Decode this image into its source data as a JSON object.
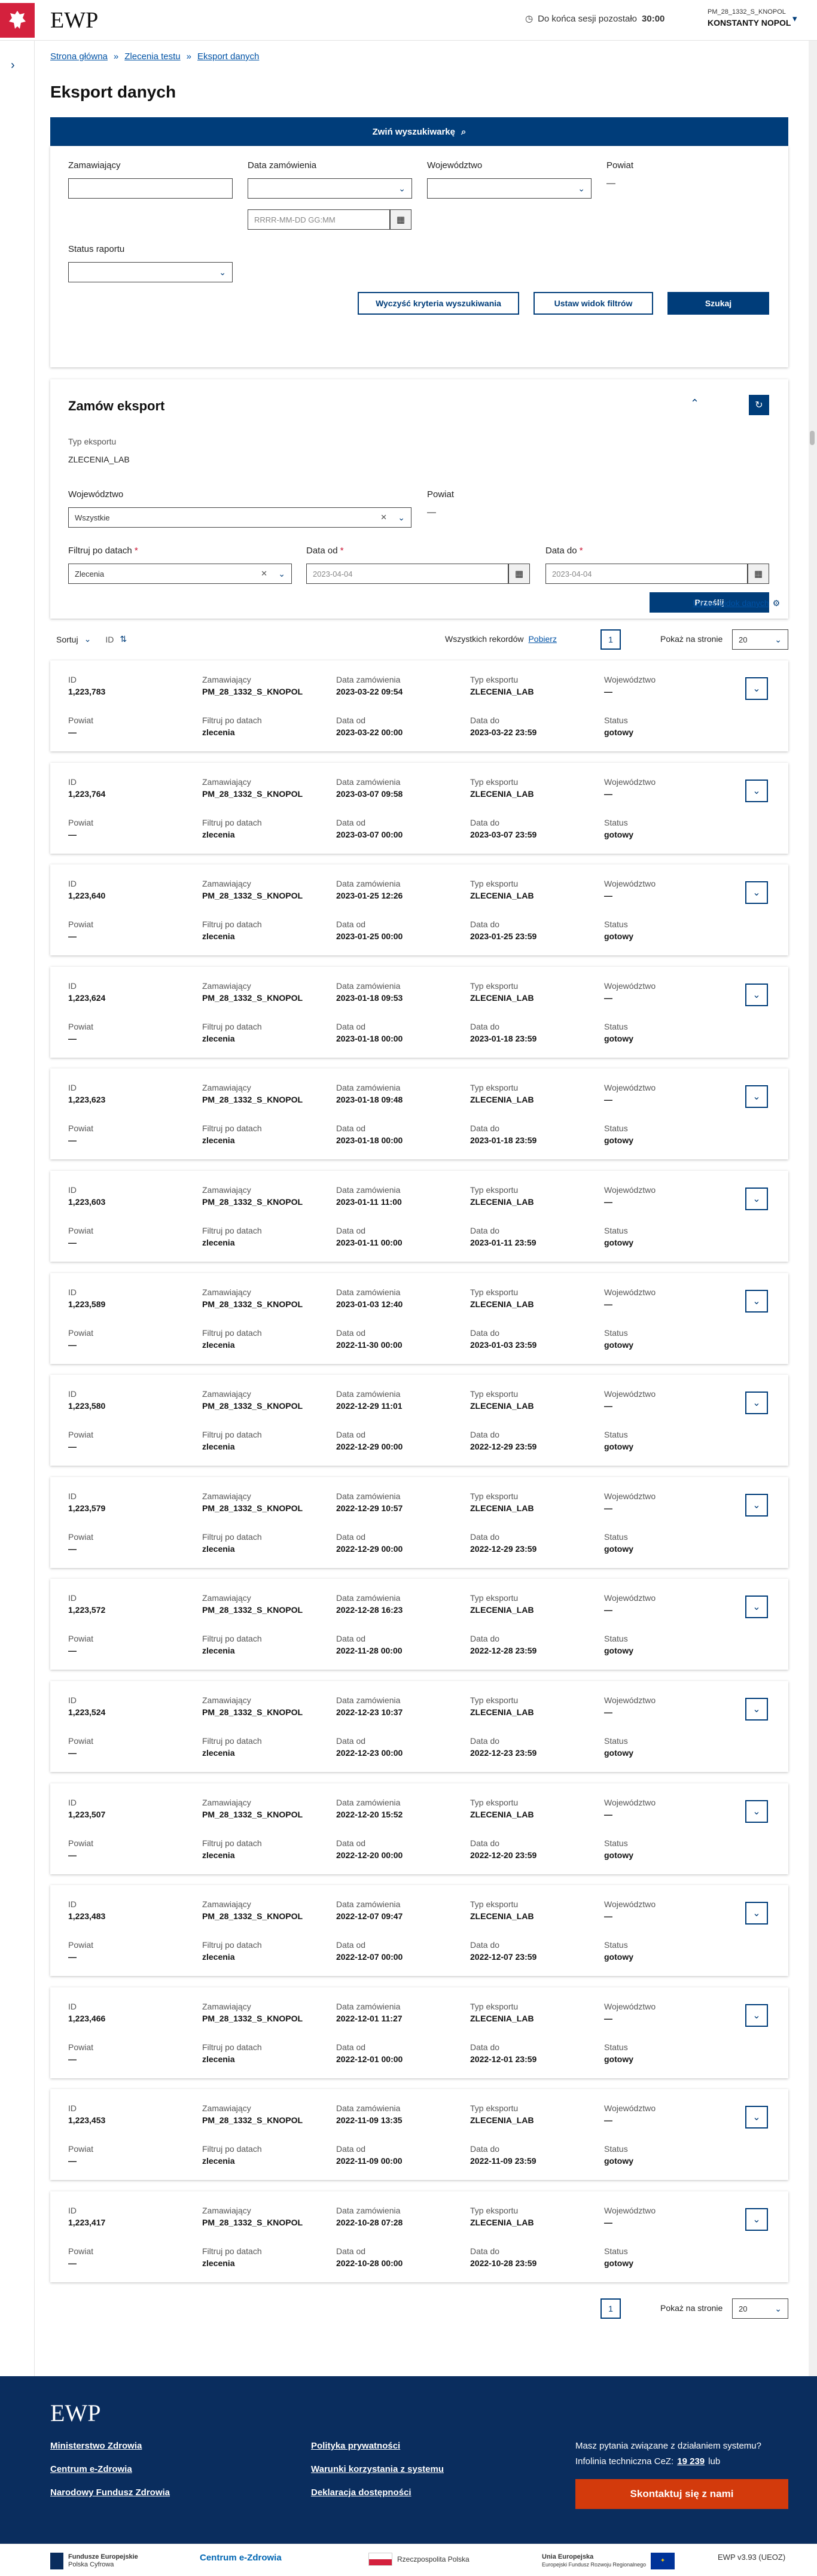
{
  "header": {
    "app_title": "EWP",
    "session_label": "Do końca sesji pozostało",
    "session_time": "30:00",
    "user_id": "PM_28_1332_S_KNOPOL",
    "user_name": "KONSTANTY NOPOL"
  },
  "breadcrumb": [
    "Strona główna",
    "Zlecenia testu",
    "Eksport danych"
  ],
  "page_title": "Eksport danych",
  "search": {
    "toggle_label": "Zwiń wyszukiwarkę",
    "zamawiajacy_label": "Zamawiający",
    "data_zam_label": "Data zamówienia",
    "date_placeholder": "RRRR-MM-DD GG:MM",
    "wojewodztwo_label": "Województwo",
    "powiat_label": "Powiat",
    "powiat_value": "—",
    "status_label": "Status raportu",
    "clear_label": "Wyczyść kryteria wyszukiwania",
    "setview_label": "Ustaw widok filtrów",
    "search_label": "Szukaj"
  },
  "export": {
    "title": "Zamów eksport",
    "type_label": "Typ eksportu",
    "type_value": "ZLECENIA_LAB",
    "woj_label": "Województwo",
    "woj_value": "Wszystkie",
    "powiat_label": "Powiat",
    "powiat_value": "—",
    "filter_label": "Filtruj po datach",
    "filter_value": "Zlecenia",
    "date_from_label": "Data od",
    "date_from_value": "2023-04-04",
    "date_to_label": "Data do",
    "date_to_value": "2023-04-04",
    "submit_label": "Prześlij"
  },
  "list": {
    "set_view_label": "Ustaw widok danych",
    "sort_label": "Sortuj",
    "sort_field": "ID",
    "total_label": "Wszystkich rekordów",
    "download_label": "Pobierz",
    "page": "1",
    "per_page_label": "Pokaż na stronie",
    "per_page": "20"
  },
  "col_labels": {
    "id": "ID",
    "zam": "Zamawiający",
    "data": "Data zamówienia",
    "typ": "Typ eksportu",
    "woj": "Województwo",
    "powiat": "Powiat",
    "filtr": "Filtruj po datach",
    "od": "Data od",
    "do": "Data do",
    "status": "Status"
  },
  "records": [
    {
      "id": "1,223,783",
      "zam": "PM_28_1332_S_KNOPOL",
      "data": "2023-03-22 09:54",
      "typ": "ZLECENIA_LAB",
      "woj": "—",
      "powiat": "—",
      "filtr": "zlecenia",
      "od": "2023-03-22 00:00",
      "do": "2023-03-22 23:59",
      "status": "gotowy"
    },
    {
      "id": "1,223,764",
      "zam": "PM_28_1332_S_KNOPOL",
      "data": "2023-03-07 09:58",
      "typ": "ZLECENIA_LAB",
      "woj": "—",
      "powiat": "—",
      "filtr": "zlecenia",
      "od": "2023-03-07 00:00",
      "do": "2023-03-07 23:59",
      "status": "gotowy"
    },
    {
      "id": "1,223,640",
      "zam": "PM_28_1332_S_KNOPOL",
      "data": "2023-01-25 12:26",
      "typ": "ZLECENIA_LAB",
      "woj": "—",
      "powiat": "—",
      "filtr": "zlecenia",
      "od": "2023-01-25 00:00",
      "do": "2023-01-25 23:59",
      "status": "gotowy"
    },
    {
      "id": "1,223,624",
      "zam": "PM_28_1332_S_KNOPOL",
      "data": "2023-01-18 09:53",
      "typ": "ZLECENIA_LAB",
      "woj": "—",
      "powiat": "—",
      "filtr": "zlecenia",
      "od": "2023-01-18 00:00",
      "do": "2023-01-18 23:59",
      "status": "gotowy"
    },
    {
      "id": "1,223,623",
      "zam": "PM_28_1332_S_KNOPOL",
      "data": "2023-01-18 09:48",
      "typ": "ZLECENIA_LAB",
      "woj": "—",
      "powiat": "—",
      "filtr": "zlecenia",
      "od": "2023-01-18 00:00",
      "do": "2023-01-18 23:59",
      "status": "gotowy"
    },
    {
      "id": "1,223,603",
      "zam": "PM_28_1332_S_KNOPOL",
      "data": "2023-01-11 11:00",
      "typ": "ZLECENIA_LAB",
      "woj": "—",
      "powiat": "—",
      "filtr": "zlecenia",
      "od": "2023-01-11 00:00",
      "do": "2023-01-11 23:59",
      "status": "gotowy"
    },
    {
      "id": "1,223,589",
      "zam": "PM_28_1332_S_KNOPOL",
      "data": "2023-01-03 12:40",
      "typ": "ZLECENIA_LAB",
      "woj": "—",
      "powiat": "—",
      "filtr": "zlecenia",
      "od": "2022-11-30 00:00",
      "do": "2023-01-03 23:59",
      "status": "gotowy"
    },
    {
      "id": "1,223,580",
      "zam": "PM_28_1332_S_KNOPOL",
      "data": "2022-12-29 11:01",
      "typ": "ZLECENIA_LAB",
      "woj": "—",
      "powiat": "—",
      "filtr": "zlecenia",
      "od": "2022-12-29 00:00",
      "do": "2022-12-29 23:59",
      "status": "gotowy"
    },
    {
      "id": "1,223,579",
      "zam": "PM_28_1332_S_KNOPOL",
      "data": "2022-12-29 10:57",
      "typ": "ZLECENIA_LAB",
      "woj": "—",
      "powiat": "—",
      "filtr": "zlecenia",
      "od": "2022-12-29 00:00",
      "do": "2022-12-29 23:59",
      "status": "gotowy"
    },
    {
      "id": "1,223,572",
      "zam": "PM_28_1332_S_KNOPOL",
      "data": "2022-12-28 16:23",
      "typ": "ZLECENIA_LAB",
      "woj": "—",
      "powiat": "—",
      "filtr": "zlecenia",
      "od": "2022-11-28 00:00",
      "do": "2022-12-28 23:59",
      "status": "gotowy"
    },
    {
      "id": "1,223,524",
      "zam": "PM_28_1332_S_KNOPOL",
      "data": "2022-12-23 10:37",
      "typ": "ZLECENIA_LAB",
      "woj": "—",
      "powiat": "—",
      "filtr": "zlecenia",
      "od": "2022-12-23 00:00",
      "do": "2022-12-23 23:59",
      "status": "gotowy"
    },
    {
      "id": "1,223,507",
      "zam": "PM_28_1332_S_KNOPOL",
      "data": "2022-12-20 15:52",
      "typ": "ZLECENIA_LAB",
      "woj": "—",
      "powiat": "—",
      "filtr": "zlecenia",
      "od": "2022-12-20 00:00",
      "do": "2022-12-20 23:59",
      "status": "gotowy"
    },
    {
      "id": "1,223,483",
      "zam": "PM_28_1332_S_KNOPOL",
      "data": "2022-12-07 09:47",
      "typ": "ZLECENIA_LAB",
      "woj": "—",
      "powiat": "—",
      "filtr": "zlecenia",
      "od": "2022-12-07 00:00",
      "do": "2022-12-07 23:59",
      "status": "gotowy"
    },
    {
      "id": "1,223,466",
      "zam": "PM_28_1332_S_KNOPOL",
      "data": "2022-12-01 11:27",
      "typ": "ZLECENIA_LAB",
      "woj": "—",
      "powiat": "—",
      "filtr": "zlecenia",
      "od": "2022-12-01 00:00",
      "do": "2022-12-01 23:59",
      "status": "gotowy"
    },
    {
      "id": "1,223,453",
      "zam": "PM_28_1332_S_KNOPOL",
      "data": "2022-11-09 13:35",
      "typ": "ZLECENIA_LAB",
      "woj": "—",
      "powiat": "—",
      "filtr": "zlecenia",
      "od": "2022-11-09 00:00",
      "do": "2022-11-09 23:59",
      "status": "gotowy"
    },
    {
      "id": "1,223,417",
      "zam": "PM_28_1332_S_KNOPOL",
      "data": "2022-10-28 07:28",
      "typ": "ZLECENIA_LAB",
      "woj": "—",
      "powiat": "—",
      "filtr": "zlecenia",
      "od": "2022-10-28 00:00",
      "do": "2022-10-28 23:59",
      "status": "gotowy"
    }
  ],
  "footer": {
    "title": "EWP",
    "links": [
      "Ministerstwo Zdrowia",
      "Centrum e-Zdrowia",
      "Narodowy Fundusz Zdrowia",
      "Polityka prywatności",
      "Warunki korzystania z systemu",
      "Deklaracja dostępności"
    ],
    "question": "Masz pytania związane z działaniem systemu?",
    "infoline_label": "Infolinia techniczna CeZ:",
    "infoline_number": "19 239",
    "infoline_suffix": "lub",
    "contact_label": "Skontaktuj się z nami"
  },
  "logos": {
    "fe": "Fundusze Europejskie",
    "fe_sub": "Polska Cyfrowa",
    "cez": "Centrum e-Zdrowia",
    "rp": "Rzeczpospolita Polska",
    "ue": "Unia Europejska",
    "ue_sub": "Europejski Fundusz Rozwoju Regionalnego",
    "version": "EWP v3.93 (UEOZ)"
  }
}
